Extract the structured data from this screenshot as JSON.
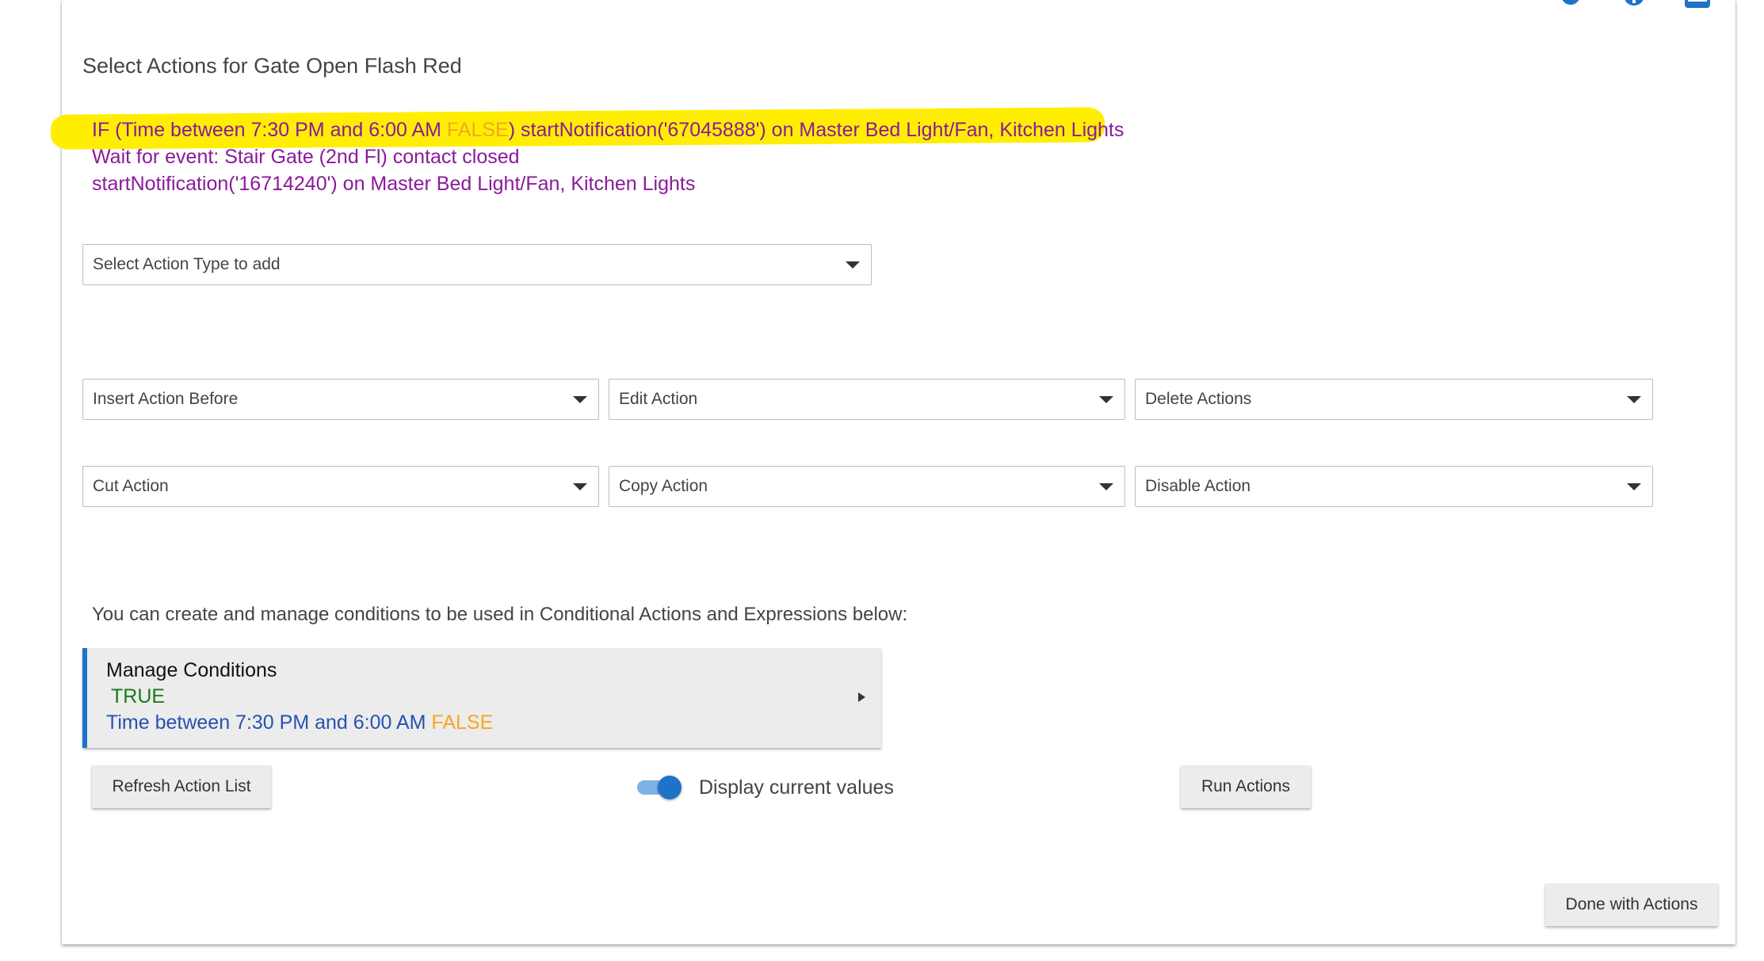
{
  "header": {
    "title": "Select Actions for Gate Open Flash Red",
    "icons": [
      "gear-icon",
      "help-icon",
      "window-icon"
    ]
  },
  "actions": {
    "line1_prefix": "IF (Time between 7:30 PM and 6:00 AM ",
    "line1_status": "FALSE",
    "line1_suffix": ") startNotification('67045888') on Master Bed Light/Fan, Kitchen Lights",
    "line2": "Wait for event: Stair Gate (2nd Fl) contact closed",
    "line3": "startNotification('16714240') on Master Bed Light/Fan, Kitchen Lights"
  },
  "selects": {
    "action_type": "Select Action Type to add",
    "insert_before": "Insert Action Before",
    "edit": "Edit Action",
    "delete": "Delete Actions",
    "cut": "Cut Action",
    "copy": "Copy Action",
    "disable": "Disable Action"
  },
  "conditions": {
    "intro": "You can create and manage conditions to be used in Conditional Actions and Expressions below:",
    "panel_title": "Manage Conditions",
    "overall_status": "TRUE",
    "condition_text": "Time between 7:30 PM and 6:00 AM ",
    "condition_status": "FALSE"
  },
  "buttons": {
    "refresh": "Refresh Action List",
    "run": "Run Actions",
    "done": "Done with Actions"
  },
  "toggle": {
    "label": "Display current values",
    "checked": true
  },
  "colors": {
    "accent": "#1e73c9",
    "highlight": "#ffee00",
    "action_text": "#8b1a9b",
    "false_text": "#f5a623",
    "true_text": "#1a7a1a",
    "condition_text": "#2552b3"
  }
}
